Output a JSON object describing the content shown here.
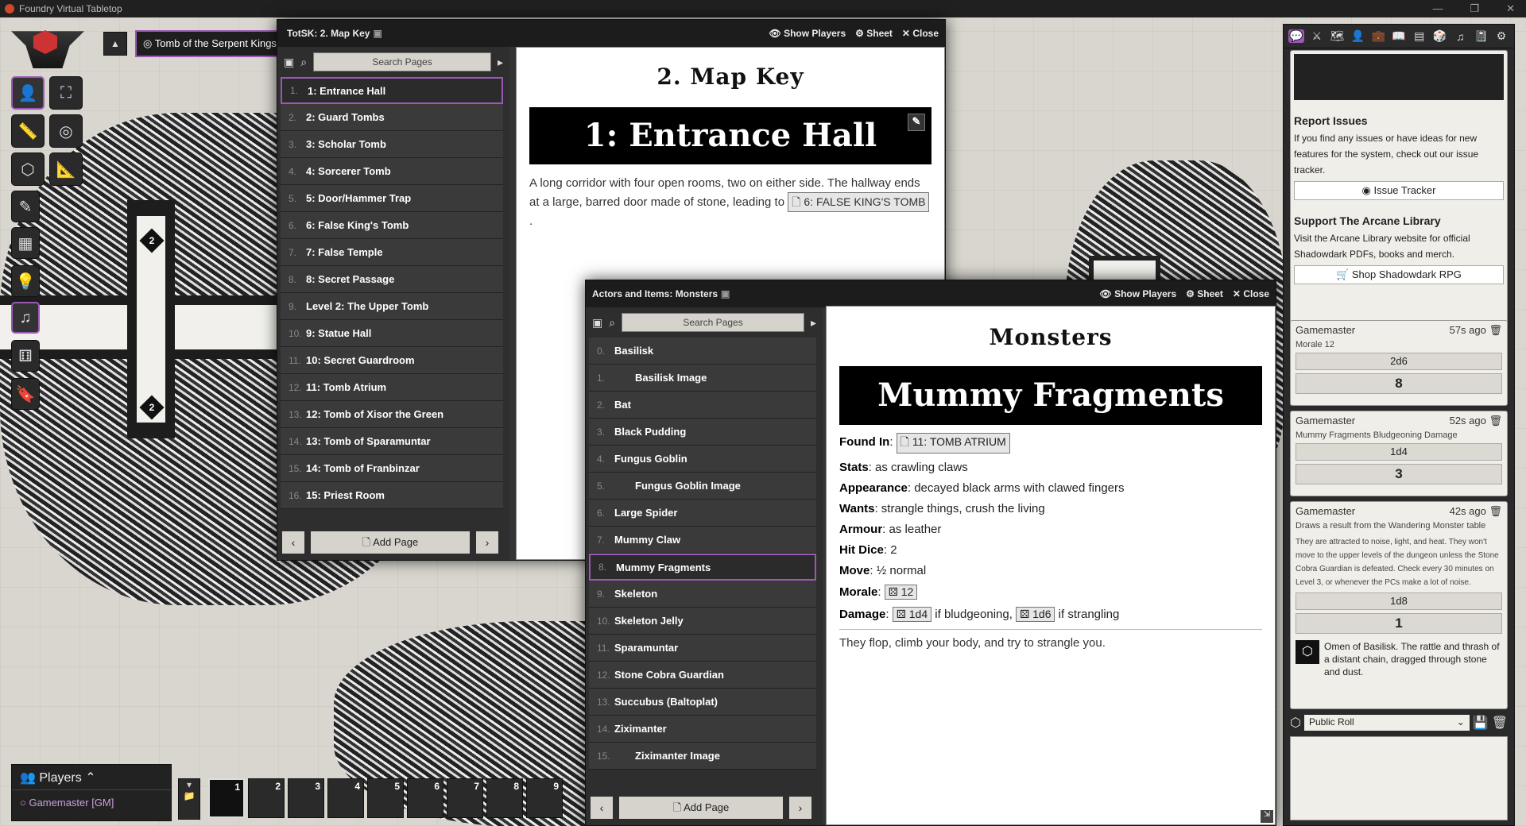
{
  "window": {
    "title": "Foundry Virtual Tabletop",
    "buttons": [
      "—",
      "❐",
      "✕"
    ]
  },
  "scene_nav": {
    "scene_name": "Tomb of the Serpent Kings",
    "toggle_icon": "▲"
  },
  "scene_controls": [
    "👤",
    "⛶",
    "📏",
    "◎",
    "⬡",
    "📐",
    "✎",
    "▦",
    "💡",
    "♫",
    "⚅",
    "🔖"
  ],
  "map_key_window": {
    "title": "TotSK: 2. Map Key",
    "show_players": "Show Players",
    "sheet": "Sheet",
    "close": "Close",
    "search_placeholder": "Search Pages",
    "pages": [
      {
        "num": "1.",
        "label": "1: Entrance Hall",
        "selected": true
      },
      {
        "num": "2.",
        "label": "2: Guard Tombs"
      },
      {
        "num": "3.",
        "label": "3: Scholar Tomb"
      },
      {
        "num": "4.",
        "label": "4: Sorcerer Tomb"
      },
      {
        "num": "5.",
        "label": "5: Door/Hammer Trap"
      },
      {
        "num": "6.",
        "label": "6: False King's Tomb"
      },
      {
        "num": "7.",
        "label": "7: False Temple"
      },
      {
        "num": "8.",
        "label": "8: Secret Passage"
      },
      {
        "num": "9.",
        "label": "Level 2: The Upper Tomb"
      },
      {
        "num": "10.",
        "label": "9: Statue Hall"
      },
      {
        "num": "11.",
        "label": "10: Secret Guardroom"
      },
      {
        "num": "12.",
        "label": "11: Tomb Atrium"
      },
      {
        "num": "13.",
        "label": "12: Tomb of Xisor the Green"
      },
      {
        "num": "14.",
        "label": "13: Tomb of Sparamuntar"
      },
      {
        "num": "15.",
        "label": "14: Tomb of Franbinzar"
      },
      {
        "num": "16.",
        "label": "15: Priest Room"
      }
    ],
    "add_page": "Add Page",
    "page_title": "2. Map Key",
    "banner": "1: Entrance Hall",
    "body": "A long corridor with four open rooms, two on either side. The hallway ends at a large, barred door made of stone, leading to",
    "ref": "6: FALSE KING'S TOMB"
  },
  "monsters_window": {
    "title": "Actors and Items: Monsters",
    "show_players": "Show Players",
    "sheet": "Sheet",
    "close": "Close",
    "search_placeholder": "Search Pages",
    "pages": [
      {
        "num": "0.",
        "label": "Basilisk"
      },
      {
        "num": "1.",
        "label": "Basilisk Image",
        "sub": true
      },
      {
        "num": "2.",
        "label": "Bat"
      },
      {
        "num": "3.",
        "label": "Black Pudding"
      },
      {
        "num": "4.",
        "label": "Fungus Goblin"
      },
      {
        "num": "5.",
        "label": "Fungus Goblin Image",
        "sub": true
      },
      {
        "num": "6.",
        "label": "Large Spider"
      },
      {
        "num": "7.",
        "label": "Mummy Claw"
      },
      {
        "num": "8.",
        "label": "Mummy Fragments",
        "selected": true
      },
      {
        "num": "9.",
        "label": "Skeleton"
      },
      {
        "num": "10.",
        "label": "Skeleton Jelly"
      },
      {
        "num": "11.",
        "label": "Sparamuntar"
      },
      {
        "num": "12.",
        "label": "Stone Cobra Guardian"
      },
      {
        "num": "13.",
        "label": "Succubus (Baltoplat)"
      },
      {
        "num": "14.",
        "label": "Ziximanter"
      },
      {
        "num": "15.",
        "label": "Ziximanter Image",
        "sub": true
      }
    ],
    "add_page": "Add Page",
    "page_title": "Monsters",
    "banner": "Mummy Fragments",
    "stats": [
      {
        "k": "Found In",
        "v": "",
        "ref": "11: TOMB ATRIUM"
      },
      {
        "k": "Stats",
        "v": "as crawling claws"
      },
      {
        "k": "Appearance",
        "v": "decayed black arms with clawed fingers"
      },
      {
        "k": "Wants",
        "v": "strangle things, crush the living"
      },
      {
        "k": "Armour",
        "v": "as leather"
      },
      {
        "k": "Hit Dice",
        "v": "2"
      },
      {
        "k": "Move",
        "v": "½ normal"
      },
      {
        "k": "Morale",
        "v": "",
        "ref": "12"
      },
      {
        "k": "Damage",
        "v": ""
      }
    ],
    "damage": {
      "r1": "1d4",
      "t1": "if bludgeoning,",
      "r2": "1d6",
      "t2": "if strangling"
    },
    "flavor": "They flop, climb your body, and try to strangle you."
  },
  "sidebar": {
    "tabs": [
      "💬",
      "⚔",
      "🗺",
      "👤",
      "💼",
      "📖",
      "▤",
      "🎲",
      "♫",
      "📓",
      "⚙"
    ],
    "report_title": "Report Issues",
    "report_text": "If you find any issues or have ideas for new features for the system, check out our issue tracker.",
    "issue_btn": "Issue Tracker",
    "support_title": "Support The Arcane Library",
    "support_text": "Visit the Arcane Library website for official Shadowdark PDFs, books and merch.",
    "shop_btn": "Shop Shadowdark RPG",
    "messages": [
      {
        "author": "Gamemaster",
        "time": "57s ago",
        "flavor": "Morale 12",
        "formula": "2d6",
        "total": "8"
      },
      {
        "author": "Gamemaster",
        "time": "52s ago",
        "flavor": "Mummy Fragments Bludgeoning Damage",
        "formula": "1d4",
        "total": "3"
      },
      {
        "author": "Gamemaster",
        "time": "42s ago",
        "flavor": "Draws a result from the Wandering Monster table",
        "desc": "They are attracted to noise, light, and heat. They won't move to the upper levels of the dungeon unless the Stone Cobra Guardian is defeated. Check every 30 minutes on Level 3, or whenever the PCs make a lot of noise.",
        "formula": "1d8",
        "total": "1",
        "result": "Omen of Basilisk. The rattle and thrash of a distant chain, dragged through stone and dust."
      }
    ],
    "roll_mode": "Public Roll"
  },
  "players": {
    "title": "Players",
    "user": "Gamemaster [GM]"
  },
  "hotbar": [
    "1",
    "2",
    "3",
    "4",
    "5",
    "6",
    "7",
    "8",
    "9"
  ],
  "colors": {
    "accent": "#9b59b6",
    "dark": "#2a2a2a"
  }
}
